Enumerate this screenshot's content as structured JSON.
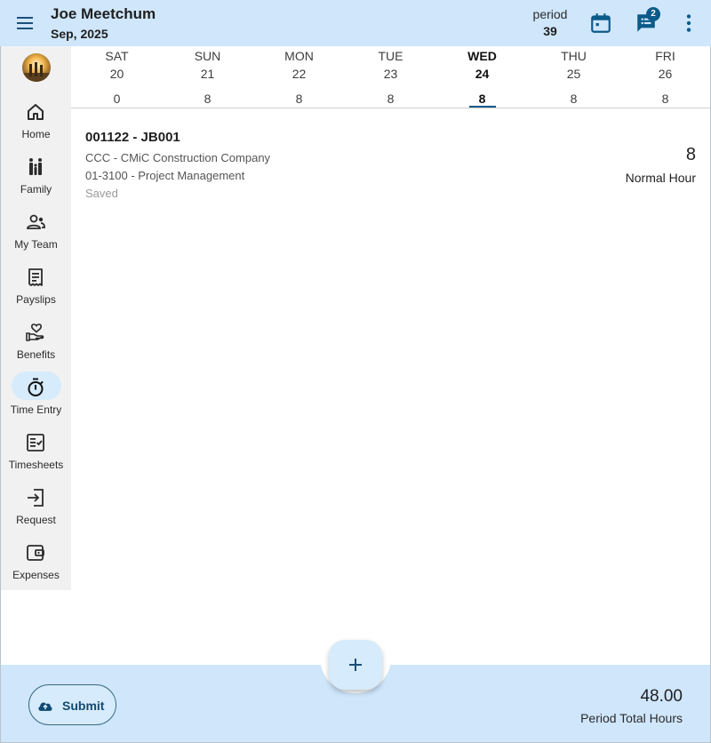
{
  "header": {
    "user_name": "Joe Meetchum",
    "date": "Sep, 2025",
    "period_label": "period",
    "period_value": "39",
    "messages_badge": "2",
    "icons": [
      "menu-icon",
      "calendar-icon",
      "chat-list-icon",
      "more-vert-icon"
    ]
  },
  "sidebar": {
    "items": [
      {
        "label": "Home",
        "icon": "home-icon",
        "active": false
      },
      {
        "label": "Family",
        "icon": "family-icon",
        "active": false
      },
      {
        "label": "My Team",
        "icon": "team-icon",
        "active": false
      },
      {
        "label": "Payslips",
        "icon": "payslip-icon",
        "active": false
      },
      {
        "label": "Benefits",
        "icon": "benefits-icon",
        "active": false
      },
      {
        "label": "Time Entry",
        "icon": "timer-icon",
        "active": true
      },
      {
        "label": "Timesheets",
        "icon": "timesheet-icon",
        "active": false
      },
      {
        "label": "Request",
        "icon": "request-icon",
        "active": false
      },
      {
        "label": "Expenses",
        "icon": "wallet-icon",
        "active": false
      }
    ]
  },
  "days": [
    {
      "name": "SAT",
      "date": "20",
      "hours": "0",
      "active": false
    },
    {
      "name": "SUN",
      "date": "21",
      "hours": "8",
      "active": false
    },
    {
      "name": "MON",
      "date": "22",
      "hours": "8",
      "active": false
    },
    {
      "name": "TUE",
      "date": "23",
      "hours": "8",
      "active": false
    },
    {
      "name": "WED",
      "date": "24",
      "hours": "8",
      "active": true
    },
    {
      "name": "THU",
      "date": "25",
      "hours": "8",
      "active": false
    },
    {
      "name": "FRI",
      "date": "26",
      "hours": "8",
      "active": false
    }
  ],
  "entry": {
    "title": "001122 - JB001",
    "company": "CCC - CMiC Construction Company",
    "cost_code": "01-3100 - Project Management",
    "status": "Saved",
    "hours": "8",
    "hour_type": "Normal Hour"
  },
  "footer": {
    "submit_label": "Submit",
    "submit_icon": "cloud-upload-icon",
    "total_hours": "48.00",
    "total_label": "Period Total Hours",
    "fab_icon": "plus-icon"
  },
  "colors": {
    "accent": "#0b5a8a",
    "header_bg": "#cfe6fb",
    "sidebar_bg": "#f1f1f1"
  }
}
